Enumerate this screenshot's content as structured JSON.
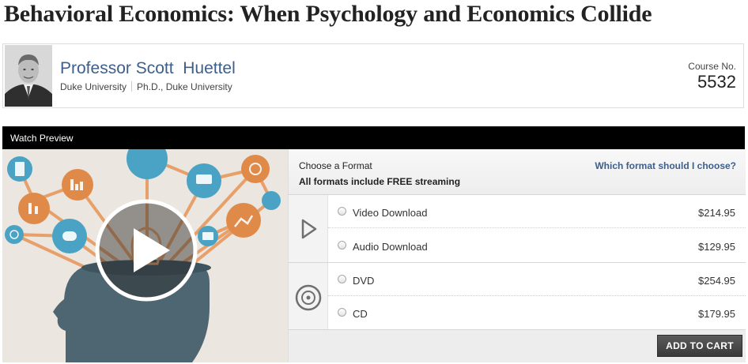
{
  "course": {
    "title": "Behavioral Economics: When Psychology and Economics Collide",
    "number_label": "Course No.",
    "number": "5532"
  },
  "professor": {
    "name": "Professor Scott  Huettel",
    "institution": "Duke University",
    "degree": "Ph.D., Duke University"
  },
  "preview": {
    "label": "Watch Preview"
  },
  "formats": {
    "title": "Choose a Format",
    "subtitle": "All formats include FREE streaming",
    "help_link": "Which format should I choose?",
    "digital": [
      {
        "label": "Video Download",
        "price": "$214.95"
      },
      {
        "label": "Audio Download",
        "price": "$129.95"
      }
    ],
    "physical": [
      {
        "label": "DVD",
        "price": "$254.95"
      },
      {
        "label": "CD",
        "price": "$179.95"
      }
    ],
    "digital_icon": "play-outline-icon",
    "physical_icon": "disc-icon"
  },
  "actions": {
    "add_to_cart": "ADD TO CART"
  },
  "colors": {
    "accent_blue": "#3d5f8a",
    "preview_bar": "#000000",
    "icon_teal": "#4aa3c4",
    "icon_orange": "#e08a4a",
    "head_slate": "#4e6672"
  }
}
